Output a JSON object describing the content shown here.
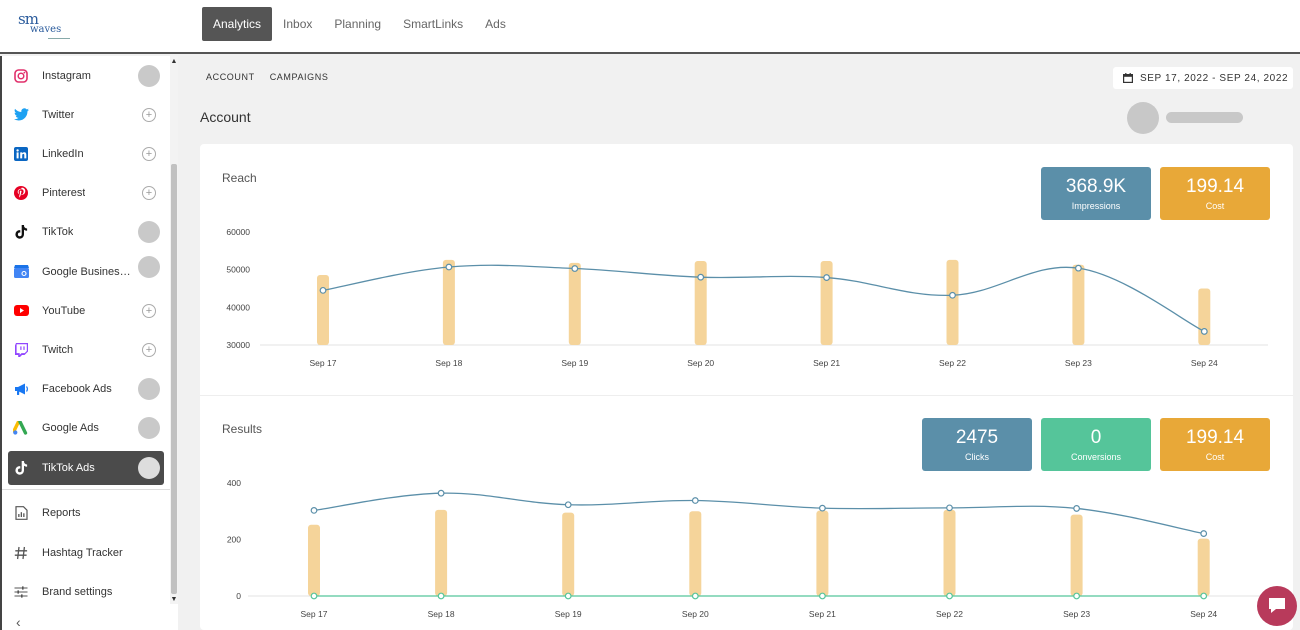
{
  "logo": {
    "sm": "sm",
    "waves": "waves"
  },
  "nav": [
    "Analytics",
    "Inbox",
    "Planning",
    "SmartLinks",
    "Ads"
  ],
  "nav_active": 0,
  "sidebar": {
    "items": [
      {
        "label": "Instagram",
        "icon": "instagram-icon",
        "color": "#e1306c",
        "control": "circle"
      },
      {
        "label": "Twitter",
        "icon": "twitter-icon",
        "color": "#1da1f2",
        "control": "plus"
      },
      {
        "label": "LinkedIn",
        "icon": "linkedin-icon",
        "color": "#0a66c2",
        "control": "plus"
      },
      {
        "label": "Pinterest",
        "icon": "pinterest-icon",
        "color": "#e60023",
        "control": "plus"
      },
      {
        "label": "TikTok",
        "icon": "tiktok-icon",
        "color": "#111111",
        "control": "circle"
      },
      {
        "label": "Google Business Profile",
        "icon": "google-business-icon",
        "color": "#4285f4",
        "control": "circle"
      },
      {
        "label": "YouTube",
        "icon": "youtube-icon",
        "color": "#ff0000",
        "control": "plus"
      },
      {
        "label": "Twitch",
        "icon": "twitch-icon",
        "color": "#9146ff",
        "control": "plus"
      },
      {
        "label": "Facebook Ads",
        "icon": "megaphone-icon",
        "color": "#1877f2",
        "control": "circle"
      },
      {
        "label": "Google Ads",
        "icon": "google-ads-icon",
        "color": "#34a853",
        "control": "circle"
      },
      {
        "label": "TikTok Ads",
        "icon": "tiktok-icon",
        "color": "#ffffff",
        "control": "circle",
        "active": true
      }
    ],
    "tools": [
      {
        "label": "Reports",
        "icon": "report-icon"
      },
      {
        "label": "Hashtag Tracker",
        "icon": "hashtag-icon"
      },
      {
        "label": "Brand settings",
        "icon": "sliders-icon"
      }
    ]
  },
  "subtabs": [
    "ACCOUNT",
    "CAMPAIGNS"
  ],
  "date_range": "SEP 17, 2022 - SEP 24, 2022",
  "page_title": "Account",
  "reach": {
    "title": "Reach",
    "metrics": [
      {
        "value": "368.9K",
        "label": "Impressions",
        "color": "#5b8fa9"
      },
      {
        "value": "199.14",
        "label": "Cost",
        "color": "#e8a838"
      }
    ]
  },
  "results": {
    "title": "Results",
    "metrics": [
      {
        "value": "2475",
        "label": "Clicks",
        "color": "#5b8fa9"
      },
      {
        "value": "0",
        "label": "Conversions",
        "color": "#55c59a"
      },
      {
        "value": "199.14",
        "label": "Cost",
        "color": "#e8a838"
      }
    ]
  },
  "chart_data": [
    {
      "type": "bar",
      "title": "Reach",
      "categories": [
        "Sep 17",
        "Sep 18",
        "Sep 19",
        "Sep 20",
        "Sep 21",
        "Sep 22",
        "Sep 23",
        "Sep 24"
      ],
      "yticks": [
        30000,
        40000,
        50000,
        60000
      ],
      "ylim": [
        30000,
        60000
      ],
      "series": [
        {
          "kind": "bar",
          "color": "#f5d49a",
          "values": [
            48600,
            52600,
            51800,
            52300,
            52300,
            52600,
            51300,
            45000
          ]
        },
        {
          "kind": "line",
          "color": "#5b8fa9",
          "values": [
            44500,
            50700,
            50300,
            48000,
            47900,
            43200,
            50400,
            33600
          ]
        }
      ]
    },
    {
      "type": "bar",
      "title": "Results",
      "categories": [
        "Sep 17",
        "Sep 18",
        "Sep 19",
        "Sep 20",
        "Sep 21",
        "Sep 22",
        "Sep 23",
        "Sep 24"
      ],
      "yticks": [
        0,
        200,
        400
      ],
      "ylim": [
        0,
        400
      ],
      "series": [
        {
          "kind": "bar",
          "color": "#f5d49a",
          "values": [
            252,
            305,
            295,
            300,
            302,
            305,
            288,
            203
          ]
        },
        {
          "kind": "line",
          "color": "#5b8fa9",
          "values": [
            303,
            364,
            323,
            338,
            311,
            312,
            310,
            221
          ]
        },
        {
          "kind": "line",
          "color": "#55c59a",
          "values": [
            0,
            0,
            0,
            0,
            0,
            0,
            0,
            0
          ]
        }
      ]
    }
  ]
}
